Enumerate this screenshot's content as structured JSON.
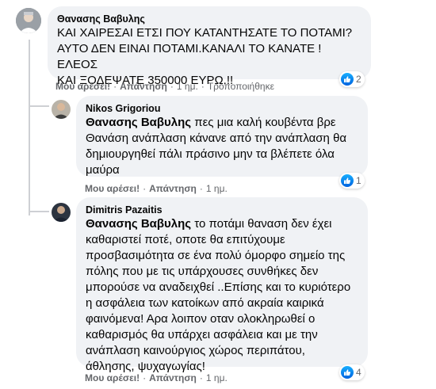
{
  "comments": [
    {
      "author": "Θανασης Βαβυλης",
      "lines": [
        "ΚΑΙ ΧΑΙΡΕΣΑΙ ΕΤΣΙ ΠΟΥ ΚΑΤΑΝΤΗΣΑΤΕ ΤΟ ΠΟΤΑΜΙ?",
        "ΑΥΤΟ ΔΕΝ ΕΙΝΑΙ ΠΟΤΑΜΙ.ΚΑΝΑΛΙ ΤΟ ΚΑΝΑΤΕ !ΕΛΕΟΣ",
        "ΚΑΙ ΞΟΔΕΨΑΤΕ 350000 ΕΥΡΩ.!!"
      ],
      "like_label": "Μου αρέσει!",
      "reply_label": "Απάντηση",
      "time": "1 ημ.",
      "edited": "Τροποποιήθηκε",
      "reactions": "2"
    },
    {
      "author": "Nikos Grigoriou",
      "mention": "Θανασης Βαβυλης",
      "lines": [
        " πες μια καλή κουβέντα βρε",
        "Θανάση ανάπλαση κάνανε από την ανάπλαση θα",
        "δημιουργηθεί πάλι πράσινο μην τα βλέπετε όλα",
        "μαύρα"
      ],
      "like_label": "Μου αρέσει!",
      "reply_label": "Απάντηση",
      "time": "1 ημ.",
      "reactions": "1"
    },
    {
      "author": "Dimitris Pazaitis",
      "mention": "Θανασης Βαβυλης",
      "lines": [
        " το ποτάμι θαναση δεν έχει",
        "καθαριστεί ποτέ, οποτε θα επιτύχουμε",
        "προσβασιμότητα σε ένα πολύ όμορφο σημείο της",
        "πόλης που με τις υπάρχουσες συνθήκες δεν",
        "μπορούσε να αναδειχθεί ..Επίσης και το κυριότερο",
        "η ασφάλεια των κατοίκων από ακραία καιρικά",
        "φαινόμενα! Αρα λοιπον οταν ολοκληρωθεί ο",
        "καθαρισμός θα υπάρχει ασφάλεια και με την",
        "ανάπλαση καινούργιος χώρος περιπάτου,",
        "άθλησης, ψυχαγωγίας!"
      ],
      "like_label": "Μου αρέσει!",
      "reply_label": "Απάντηση",
      "time": "1 ημ.",
      "reactions": "4"
    }
  ],
  "colors": {
    "bubble": "#f0f2f5",
    "like_blue": "#1877f2",
    "meta": "#65676b"
  },
  "icons": {
    "reaction": "thumbs-up-icon"
  }
}
